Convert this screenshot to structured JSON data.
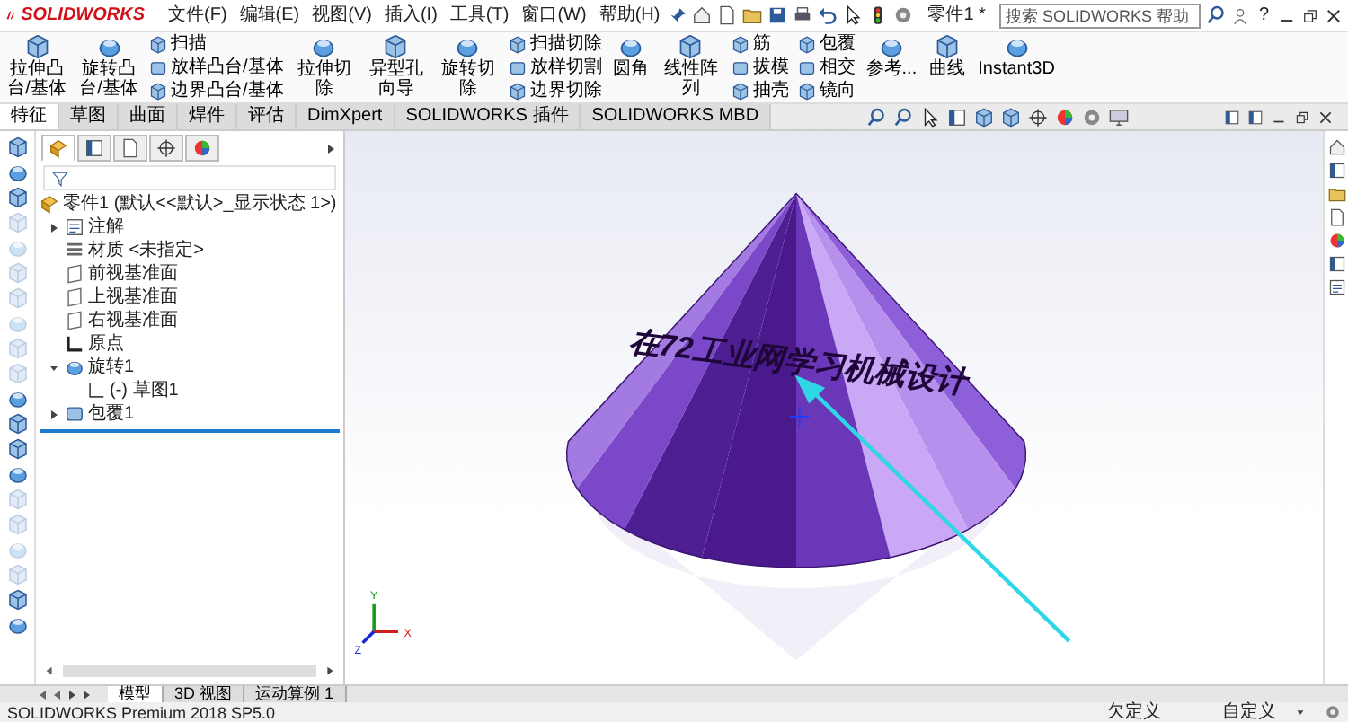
{
  "title_bar": {
    "logo": "SOLIDWORKS",
    "menus": [
      "文件(F)",
      "编辑(E)",
      "视图(V)",
      "插入(I)",
      "工具(T)",
      "窗口(W)",
      "帮助(H)"
    ],
    "document_title": "零件1 *",
    "search": {
      "placeholder": "搜索 SOLIDWORKS 帮助"
    },
    "help_mark": "?"
  },
  "ribbon": [
    {
      "kind": "large",
      "label": "拉伸凸台/基体"
    },
    {
      "kind": "large",
      "label": "旋转凸台/基体"
    },
    {
      "kind": "stack",
      "items": [
        "扫描",
        "放样凸台/基体",
        "边界凸台/基体"
      ]
    },
    {
      "kind": "large",
      "label": "拉伸切除"
    },
    {
      "kind": "large",
      "label": "异型孔向导"
    },
    {
      "kind": "large",
      "label": "旋转切除"
    },
    {
      "kind": "stack",
      "items": [
        "扫描切除",
        "放样切割",
        "边界切除"
      ]
    },
    {
      "kind": "large",
      "label": "圆角"
    },
    {
      "kind": "large",
      "label": "线性阵列"
    },
    {
      "kind": "stack",
      "items": [
        "筋",
        "拔模",
        "抽壳"
      ]
    },
    {
      "kind": "stack",
      "items": [
        "包覆",
        "相交",
        "镜向"
      ]
    },
    {
      "kind": "large",
      "label": "参考..."
    },
    {
      "kind": "large",
      "label": "曲线"
    },
    {
      "kind": "large",
      "label": "Instant3D"
    }
  ],
  "command_tabs": [
    {
      "label": "特征",
      "selected": true
    },
    {
      "label": "草图",
      "selected": false
    },
    {
      "label": "曲面",
      "selected": false
    },
    {
      "label": "焊件",
      "selected": false
    },
    {
      "label": "评估",
      "selected": false
    },
    {
      "label": "DimXpert",
      "selected": false
    },
    {
      "label": "SOLIDWORKS 插件",
      "selected": false
    },
    {
      "label": "SOLIDWORKS MBD",
      "selected": false
    }
  ],
  "left_toolbar": [
    {
      "disabled": false
    },
    {
      "disabled": false
    },
    {
      "disabled": false
    },
    {
      "disabled": true
    },
    {
      "disabled": true
    },
    {
      "disabled": true
    },
    {
      "disabled": true
    },
    {
      "disabled": true
    },
    {
      "disabled": true
    },
    {
      "disabled": true
    },
    {
      "disabled": false
    },
    {
      "disabled": false
    },
    {
      "disabled": false
    },
    {
      "disabled": false
    },
    {
      "disabled": true
    },
    {
      "disabled": true
    },
    {
      "disabled": true
    },
    {
      "disabled": true
    },
    {
      "disabled": false
    },
    {
      "disabled": false
    }
  ],
  "panel_tabs": [
    {
      "selected": true
    },
    {
      "selected": false
    },
    {
      "selected": false
    },
    {
      "selected": false
    },
    {
      "selected": false
    }
  ],
  "feature_tree": {
    "root": "零件1 (默认<<默认>_显示状态 1>)",
    "items": [
      {
        "label": "注解",
        "kind": "annotation",
        "expanded": false
      },
      {
        "label": "材质 <未指定>",
        "kind": "material"
      },
      {
        "label": "前视基准面",
        "kind": "plane"
      },
      {
        "label": "上视基准面",
        "kind": "plane"
      },
      {
        "label": "右视基准面",
        "kind": "plane"
      },
      {
        "label": "原点",
        "kind": "origin"
      },
      {
        "label": "旋转1",
        "kind": "revolve",
        "expanded": true,
        "children": [
          {
            "label": "(-) 草图1",
            "kind": "sketch"
          }
        ]
      },
      {
        "label": "包覆1",
        "kind": "wrap",
        "expanded": false
      }
    ]
  },
  "viewport": {
    "model_text": "在72工业网学习机械设计",
    "triad_labels": [
      "Y",
      "X",
      "Z"
    ]
  },
  "bottom_tabs": [
    {
      "label": "模型",
      "selected": true
    },
    {
      "label": "3D 视图",
      "selected": false
    },
    {
      "label": "运动算例 1",
      "selected": false
    }
  ],
  "status_bar": {
    "product": "SOLIDWORKS Premium 2018 SP5.0",
    "state": "欠定义",
    "units": "自定义"
  }
}
